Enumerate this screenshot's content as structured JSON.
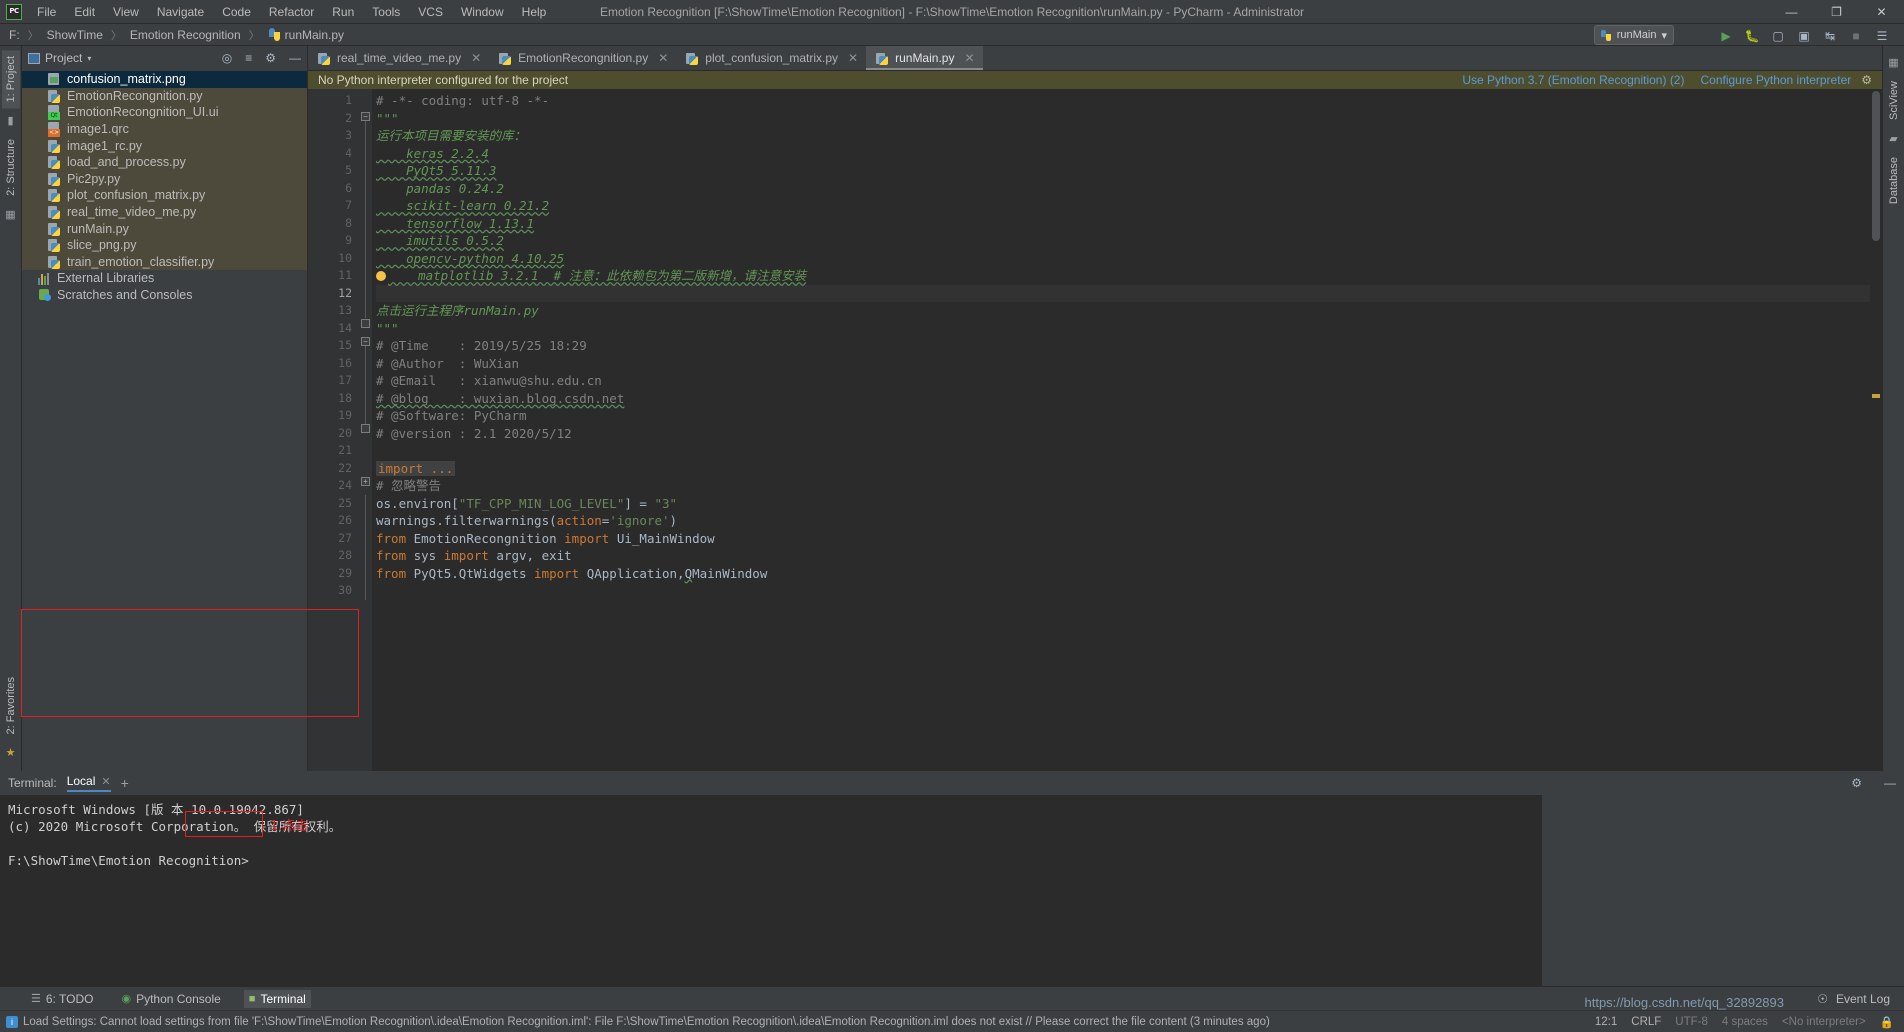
{
  "window": {
    "title": "Emotion Recognition [F:\\ShowTime\\Emotion Recognition] - F:\\ShowTime\\Emotion Recognition\\runMain.py - PyCharm - Administrator",
    "logo": "PC",
    "minimize": "—",
    "maximize": "❐",
    "close": "✕"
  },
  "menubar": {
    "items": [
      {
        "label": "File"
      },
      {
        "label": "Edit"
      },
      {
        "label": "View"
      },
      {
        "label": "Navigate"
      },
      {
        "label": "Code"
      },
      {
        "label": "Refactor"
      },
      {
        "label": "Run"
      },
      {
        "label": "Tools"
      },
      {
        "label": "VCS"
      },
      {
        "label": "Window"
      },
      {
        "label": "Help"
      }
    ]
  },
  "breadcrumb": {
    "root": "F:",
    "items": [
      "ShowTime",
      "Emotion Recognition"
    ],
    "file": "runMain.py",
    "separator": "〉"
  },
  "toolbar": {
    "run_config": "runMain",
    "caret": "▾",
    "icons": [
      "run-icon",
      "debug-icon",
      "coverage-icon",
      "profile-icon",
      "attach-icon",
      "stop-icon",
      "search-icon"
    ]
  },
  "left_strip": {
    "tabs": [
      {
        "label": "1: Project",
        "active": true
      },
      {
        "label": "2: Structure",
        "active": false
      }
    ],
    "bottom_tabs": [
      {
        "label": "2: Favorites"
      }
    ]
  },
  "right_strip": {
    "tabs": [
      {
        "label": "SciView"
      },
      {
        "label": "Database"
      }
    ]
  },
  "project_pane": {
    "title": "Project",
    "caret": "▾",
    "header_icons": [
      "locate-icon",
      "collapse-all-icon",
      "settings-icon",
      "hide-icon"
    ],
    "tree": [
      {
        "label": "confusion_matrix.png",
        "icon": "png-file-icon",
        "selected": true,
        "in_project": true
      },
      {
        "label": "EmotionRecongnition.py",
        "icon": "python-file-icon",
        "selected": false,
        "in_project": true
      },
      {
        "label": "EmotionRecongnition_UI.ui",
        "icon": "qt-ui-file-icon",
        "selected": false,
        "in_project": true
      },
      {
        "label": "image1.qrc",
        "icon": "qrc-file-icon",
        "selected": false,
        "in_project": true
      },
      {
        "label": "image1_rc.py",
        "icon": "python-file-icon",
        "selected": false,
        "in_project": true
      },
      {
        "label": "load_and_process.py",
        "icon": "python-file-icon",
        "selected": false,
        "in_project": true
      },
      {
        "label": "Pic2py.py",
        "icon": "python-file-icon",
        "selected": false,
        "in_project": true
      },
      {
        "label": "plot_confusion_matrix.py",
        "icon": "python-file-icon",
        "selected": false,
        "in_project": true
      },
      {
        "label": "real_time_video_me.py",
        "icon": "python-file-icon",
        "selected": false,
        "in_project": true
      },
      {
        "label": "runMain.py",
        "icon": "python-file-icon",
        "selected": false,
        "in_project": true
      },
      {
        "label": "slice_png.py",
        "icon": "python-file-icon",
        "selected": false,
        "in_project": true
      },
      {
        "label": "train_emotion_classifier.py",
        "icon": "python-file-icon",
        "selected": false,
        "in_project": true
      },
      {
        "label": "External Libraries",
        "icon": "library-icon",
        "selected": false,
        "in_project": false
      },
      {
        "label": "Scratches and Consoles",
        "icon": "scratches-icon",
        "selected": false,
        "in_project": false
      }
    ]
  },
  "editor": {
    "tabs": [
      {
        "label": "real_time_video_me.py",
        "active": false
      },
      {
        "label": "EmotionRecongnition.py",
        "active": false
      },
      {
        "label": "plot_confusion_matrix.py",
        "active": false
      },
      {
        "label": "runMain.py",
        "active": true
      }
    ],
    "close_glyph": "✕",
    "banner": {
      "message": "No Python interpreter configured for the project",
      "link_use": "Use Python 3.7 (Emotion Recognition) (2)",
      "link_configure": "Configure Python interpreter",
      "gear": "⚙"
    },
    "lines": [
      {
        "n": 1,
        "text": "# -*- coding: utf-8 -*-",
        "kind": "comment"
      },
      {
        "n": 2,
        "text": "\"\"\"",
        "kind": "docstr",
        "fold": "minus"
      },
      {
        "n": 3,
        "text": "运行本项目需要安装的库：",
        "kind": "docstr"
      },
      {
        "n": 4,
        "text": "    keras 2.2.4",
        "kind": "docstr",
        "spell": "keras"
      },
      {
        "n": 5,
        "text": "    PyQt5 5.11.3",
        "kind": "docstr",
        "spell": "PyQt5"
      },
      {
        "n": 6,
        "text": "    pandas 0.24.2",
        "kind": "docstr"
      },
      {
        "n": 7,
        "text": "    scikit-learn 0.21.2",
        "kind": "docstr",
        "spell": "scikit"
      },
      {
        "n": 8,
        "text": "    tensorflow 1.13.1",
        "kind": "docstr",
        "spell": "tensorflow"
      },
      {
        "n": 9,
        "text": "    imutils 0.5.2",
        "kind": "docstr",
        "spell": "imutils"
      },
      {
        "n": 10,
        "text": "    opencv-python 4.10.25",
        "kind": "docstr",
        "spell": "opencv"
      },
      {
        "n": 11,
        "text": "    matplotlib 3.2.1  # 注意：此依赖包为第二版新增，请注意安装",
        "kind": "docstr",
        "bulb": true,
        "spell": "matplotlib"
      },
      {
        "n": 12,
        "text": "",
        "kind": "blank",
        "current": true
      },
      {
        "n": 13,
        "text": "点击运行主程序runMain.py",
        "kind": "docstr"
      },
      {
        "n": 14,
        "text": "\"\"\"",
        "kind": "docstr",
        "fold": "end"
      },
      {
        "n": 15,
        "text": "# @Time    : 2019/5/25 18:29",
        "kind": "comment",
        "fold": "minus"
      },
      {
        "n": 16,
        "text": "# @Author  : WuXian",
        "kind": "comment"
      },
      {
        "n": 17,
        "text": "# @Email   : xianwu@shu.edu.cn",
        "kind": "comment"
      },
      {
        "n": 18,
        "text": "# @blog    : wuxian.blog.csdn.net",
        "kind": "comment",
        "spell": "wuxian"
      },
      {
        "n": 19,
        "text": "# @Software: PyCharm",
        "kind": "comment"
      },
      {
        "n": 20,
        "text": "# @version : 2.1 2020/5/12",
        "kind": "comment",
        "fold": "end"
      },
      {
        "n": 21,
        "text": "",
        "kind": "blank"
      },
      {
        "n": 22,
        "text": "import ...",
        "kind": "importfold",
        "fold": "plus"
      },
      {
        "n": 24,
        "text": "# 忽略警告",
        "kind": "comment"
      },
      {
        "n": 25,
        "text": "os.environ[\"TF_CPP_MIN_LOG_LEVEL\"] = \"3\"",
        "kind": "code_env"
      },
      {
        "n": 26,
        "text": "warnings.filterwarnings(action='ignore')",
        "kind": "code_warn"
      },
      {
        "n": 27,
        "text": "from EmotionRecongnition import Ui_MainWindow",
        "kind": "code_import1"
      },
      {
        "n": 28,
        "text": "from sys import argv, exit",
        "kind": "code_import2"
      },
      {
        "n": 29,
        "text": "from PyQt5.QtWidgets import QApplication,QMainWindow",
        "kind": "code_import3"
      },
      {
        "n": 30,
        "text": "",
        "kind": "blank"
      }
    ]
  },
  "terminal": {
    "label": "Terminal:",
    "tab": "Local",
    "close_glyph": "✕",
    "plus_glyph": "+",
    "settings_glyph": "⚙",
    "hide_glyph": "—",
    "output": [
      "Microsoft Windows [版 本 10.0.19042.867]",
      "(c) 2020 Microsoft Corporation。 保留所有权利。",
      "",
      "F:\\ShowTime\\Emotion Recognition>"
    ]
  },
  "bottom_bar": {
    "items": [
      {
        "label": "6: TODO",
        "icon": "todo-icon",
        "active": false
      },
      {
        "label": "Python Console",
        "icon": "python-console-icon",
        "active": false
      },
      {
        "label": "Terminal",
        "icon": "terminal-icon",
        "active": true
      }
    ],
    "right": [
      {
        "label": "Event Log",
        "icon": "event-log-icon"
      }
    ]
  },
  "annotations": [
    {
      "label": "1.点击",
      "color": "#e02020"
    }
  ],
  "status_bar": {
    "message": "Load Settings: Cannot load settings from file 'F:\\ShowTime\\Emotion Recognition\\.idea\\Emotion Recognition.iml': File F:\\ShowTime\\Emotion Recognition\\.idea\\Emotion Recognition.iml does not exist // Please correct the file content (3 minutes ago)",
    "caret": "12:1",
    "line_ending": "CRLF",
    "encoding": "UTF-8",
    "indent": "4 spaces",
    "interpreter": "<No interpreter>",
    "lock": "🔒"
  },
  "watermark": {
    "line": "https://blog.csdn.net/qq_32892893"
  }
}
